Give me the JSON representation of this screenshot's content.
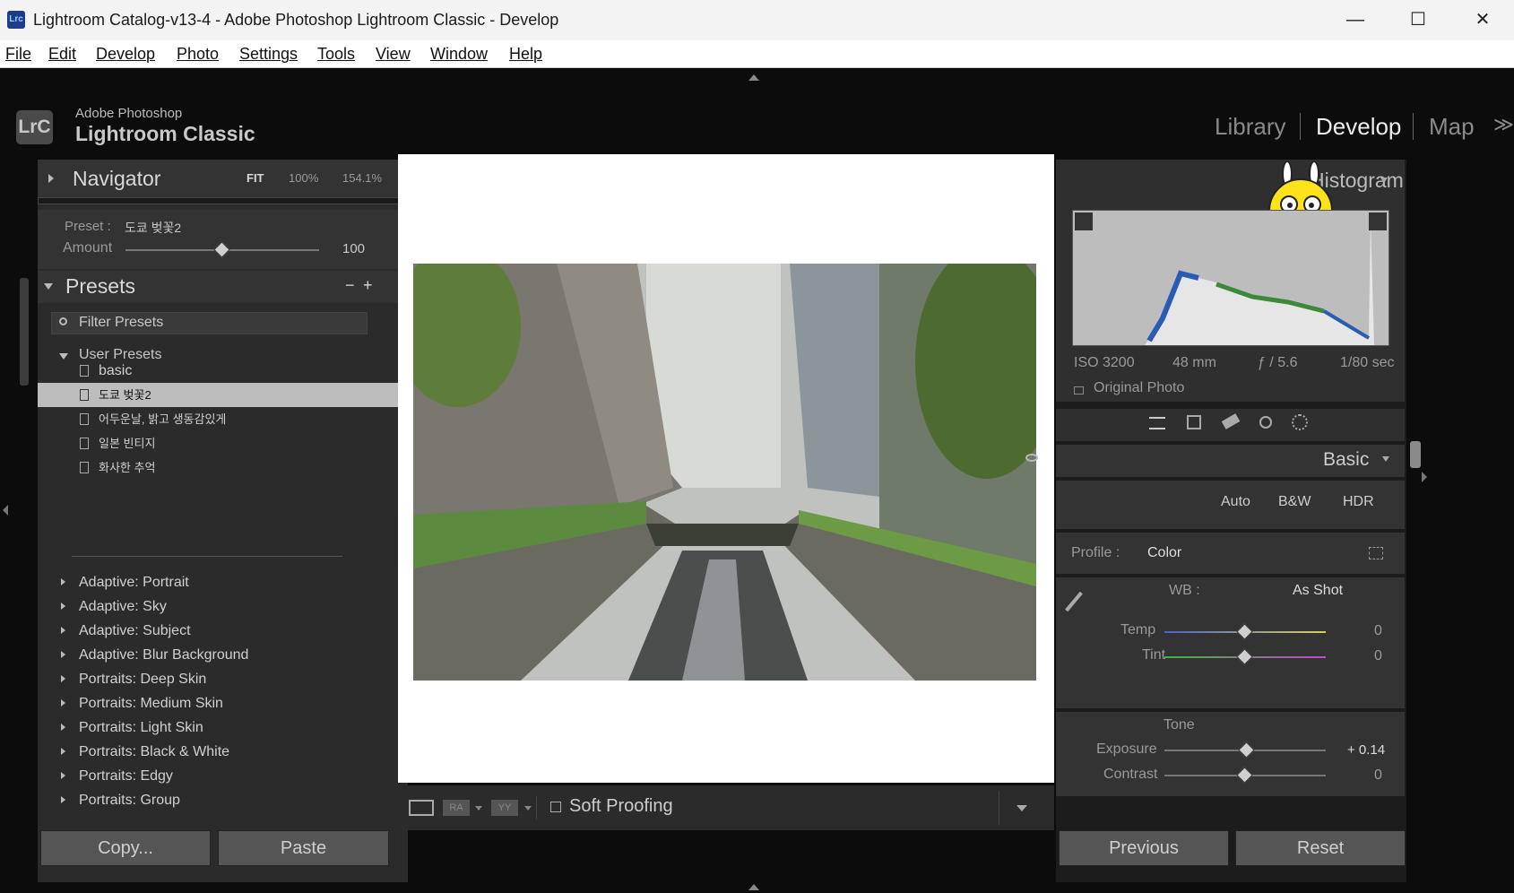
{
  "window": {
    "title": "Lightroom Catalog-v13-4 - Adobe Photoshop Lightroom Classic - Develop",
    "app_icon": "Lrc",
    "minimize": "—",
    "maximize": "☐",
    "close": "✕"
  },
  "menu": [
    "File",
    "Edit",
    "Develop",
    "Photo",
    "Settings",
    "Tools",
    "View",
    "Window",
    "Help"
  ],
  "brand": {
    "logo": "LrC",
    "sub": "Adobe Photoshop",
    "main": "Lightroom Classic"
  },
  "modules": {
    "library": "Library",
    "develop": "Develop",
    "map": "Map",
    "more": "≫"
  },
  "navigator": {
    "title": "Navigator",
    "fit": "FIT",
    "z1": "100%",
    "z2": "154.1%"
  },
  "preset_amount": {
    "preset_label": "Preset :",
    "preset_value": "도쿄 벚꽃2",
    "amount_label": "Amount",
    "amount_value": "100",
    "amount_level": 0.5
  },
  "presets": {
    "title": "Presets",
    "minus": "−",
    "plus": "+",
    "filter_placeholder": "Filter Presets",
    "user_group": "User Presets",
    "user_items": [
      "basic",
      "도쿄 벚꽃2",
      "어두운날, 밝고 생동감있게",
      "일본 빈티지",
      "화사한 추억"
    ],
    "groups": [
      "Adaptive: Portrait",
      "Adaptive: Sky",
      "Adaptive: Subject",
      "Adaptive: Blur Background",
      "Portraits: Deep Skin",
      "Portraits: Medium Skin",
      "Portraits: Light Skin",
      "Portraits: Black & White",
      "Portraits: Edgy",
      "Portraits: Group"
    ]
  },
  "left_buttons": {
    "copy": "Copy...",
    "paste": "Paste"
  },
  "toolbar": {
    "view1": "RA",
    "view2": "YY",
    "soft_proofing": "Soft Proofing"
  },
  "histogram": {
    "title": "Histogram",
    "iso": "ISO 3200",
    "focal": "48 mm",
    "aperture": "ƒ / 5.6",
    "shutter": "1/80 sec",
    "original": "Original Photo"
  },
  "basic": {
    "title": "Basic",
    "auto": "Auto",
    "bw": "B&W",
    "hdr": "HDR",
    "profile_label": "Profile :",
    "profile_value": "Color",
    "wb_label": "WB :",
    "wb_value": "As Shot",
    "temp_label": "Temp",
    "temp_value": "0",
    "temp_level": 0.5,
    "tint_label": "Tint",
    "tint_value": "0",
    "tint_level": 0.5,
    "tone_label": "Tone",
    "exposure_label": "Exposure",
    "exposure_value": "+ 0.14",
    "exposure_level": 0.51,
    "contrast_label": "Contrast",
    "contrast_value": "0",
    "contrast_level": 0.5
  },
  "right_buttons": {
    "previous": "Previous",
    "reset": "Reset"
  }
}
